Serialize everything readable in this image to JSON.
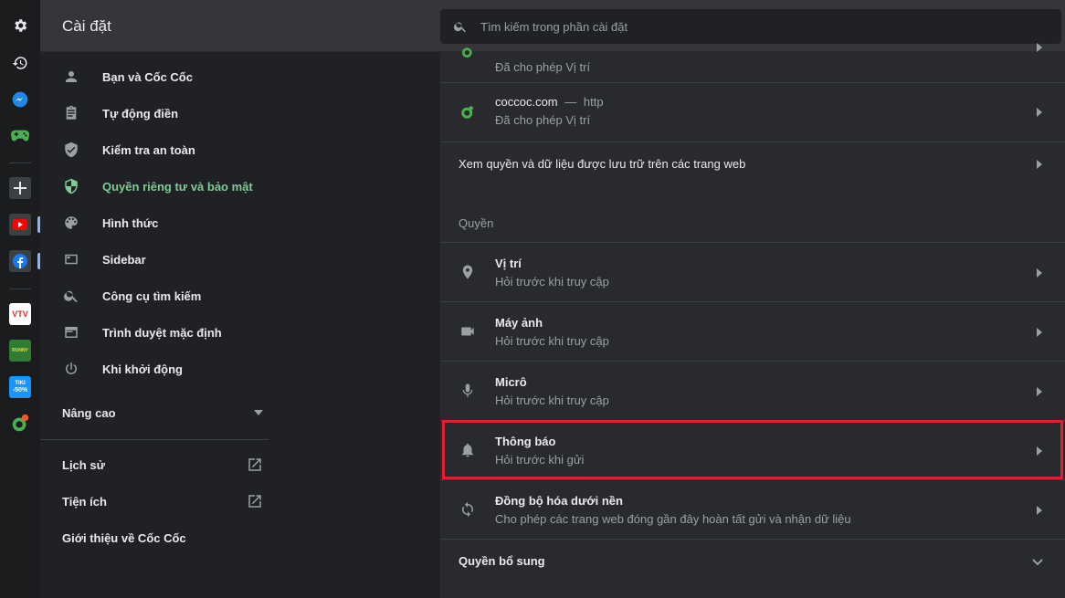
{
  "header": {
    "title": "Cài đặt",
    "search_placeholder": "Tìm kiếm trong phần cài đặt"
  },
  "rail": {
    "icons": [
      "settings-icon",
      "history-icon",
      "messenger-icon",
      "gamepad-icon",
      "add-icon",
      "youtube-icon",
      "facebook-icon",
      "vtv-go-icon",
      "game-app-icon",
      "tiki-icon",
      "coccoc-icon"
    ],
    "vtv_label": "VTV",
    "tiki_label": "TIKI",
    "tiki_sub": "-50%",
    "game_label": "RUNNY"
  },
  "nav": {
    "items": [
      {
        "label": "Bạn và Cốc Cốc",
        "icon": "person-icon"
      },
      {
        "label": "Tự động điền",
        "icon": "clipboard-icon"
      },
      {
        "label": "Kiểm tra an toàn",
        "icon": "shield-icon"
      },
      {
        "label": "Quyền riêng tư và bảo mật",
        "icon": "privacy-shield-icon"
      },
      {
        "label": "Hình thức",
        "icon": "palette-icon"
      },
      {
        "label": "Sidebar",
        "icon": "sidebar-icon"
      },
      {
        "label": "Công cụ tìm kiếm",
        "icon": "search-icon"
      },
      {
        "label": "Trình duyệt mặc định",
        "icon": "browser-icon"
      },
      {
        "label": "Khi khởi động",
        "icon": "power-icon"
      }
    ],
    "advanced_label": "Nâng cao",
    "history_label": "Lịch sử",
    "extensions_label": "Tiện ích",
    "about_label": "Giới thiệu về Cốc Cốc",
    "active_color": "#81c995"
  },
  "panel": {
    "top_row": {
      "subtitle": "Đã cho phép Vị trí"
    },
    "coccoc_row": {
      "site": "coccoc.com",
      "dash": "—",
      "scheme": "http",
      "subtitle": "Đã cho phép Vị trí"
    },
    "view_permissions": "Xem quyền và dữ liệu được lưu trữ trên các trang web",
    "section_label": "Quyền",
    "permissions": [
      {
        "title": "Vị trí",
        "subtitle": "Hỏi trước khi truy cập",
        "icon": "location-icon"
      },
      {
        "title": "Máy ảnh",
        "subtitle": "Hỏi trước khi truy cập",
        "icon": "camera-icon"
      },
      {
        "title": "Micrô",
        "subtitle": "Hỏi trước khi truy cập",
        "icon": "microphone-icon"
      },
      {
        "title": "Thông báo",
        "subtitle": "Hỏi trước khi gửi",
        "icon": "bell-icon"
      },
      {
        "title": "Đồng bộ hóa dưới nền",
        "subtitle": "Cho phép các trang web đóng gần đây hoàn tất gửi và nhận dữ liệu",
        "icon": "sync-icon"
      }
    ],
    "additional_permissions": "Quyền bổ sung"
  },
  "highlight_color": "#e0202a"
}
